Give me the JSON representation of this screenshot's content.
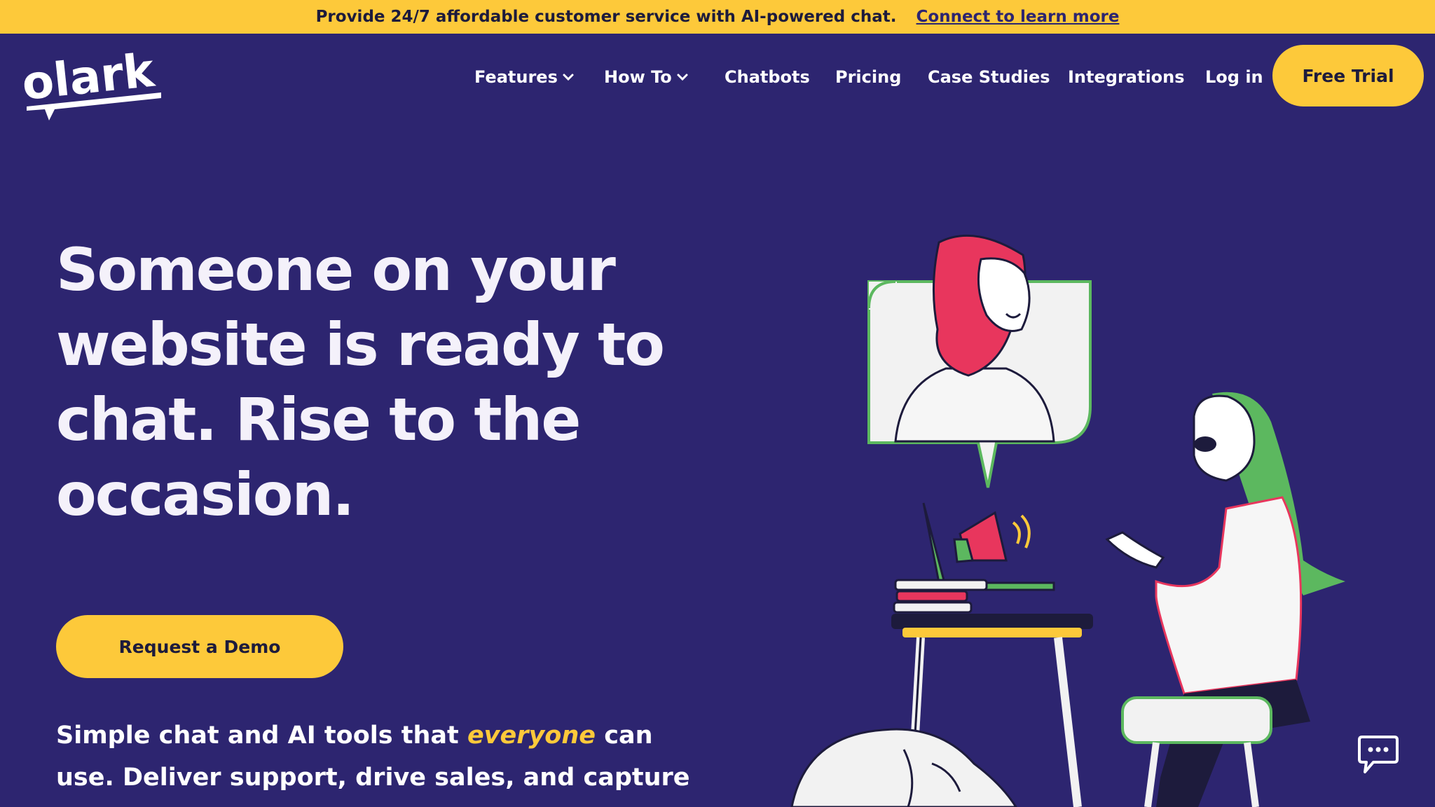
{
  "announcement": {
    "text": "Provide 24/7 affordable customer service with AI-powered chat.",
    "link": "Connect to learn more"
  },
  "brand": {
    "logo_text": "olark"
  },
  "nav": {
    "features": "Features",
    "how_to": "How To",
    "chatbots": "Chatbots",
    "pricing": "Pricing",
    "case_studies": "Case Studies",
    "integrations": "Integrations",
    "login": "Log in",
    "free_trial": "Free Trial"
  },
  "hero": {
    "headline_lines": [
      "Someone on your",
      "website is ready to",
      "chat. Rise to the",
      "occasion."
    ],
    "cta": "Request a Demo",
    "sub_line1_before": "Simple chat and AI tools that ",
    "sub_line1_em": "everyone",
    "sub_line1_after": " can",
    "sub_line2": "use. Deliver support, drive sales, and capture"
  },
  "colors": {
    "background": "#2d2570",
    "accent": "#fdc93a",
    "pink": "#e8365d",
    "green": "#5cb85f"
  },
  "icons": [
    "chevron-down-icon",
    "chat-widget-icon",
    "olark-logo"
  ]
}
